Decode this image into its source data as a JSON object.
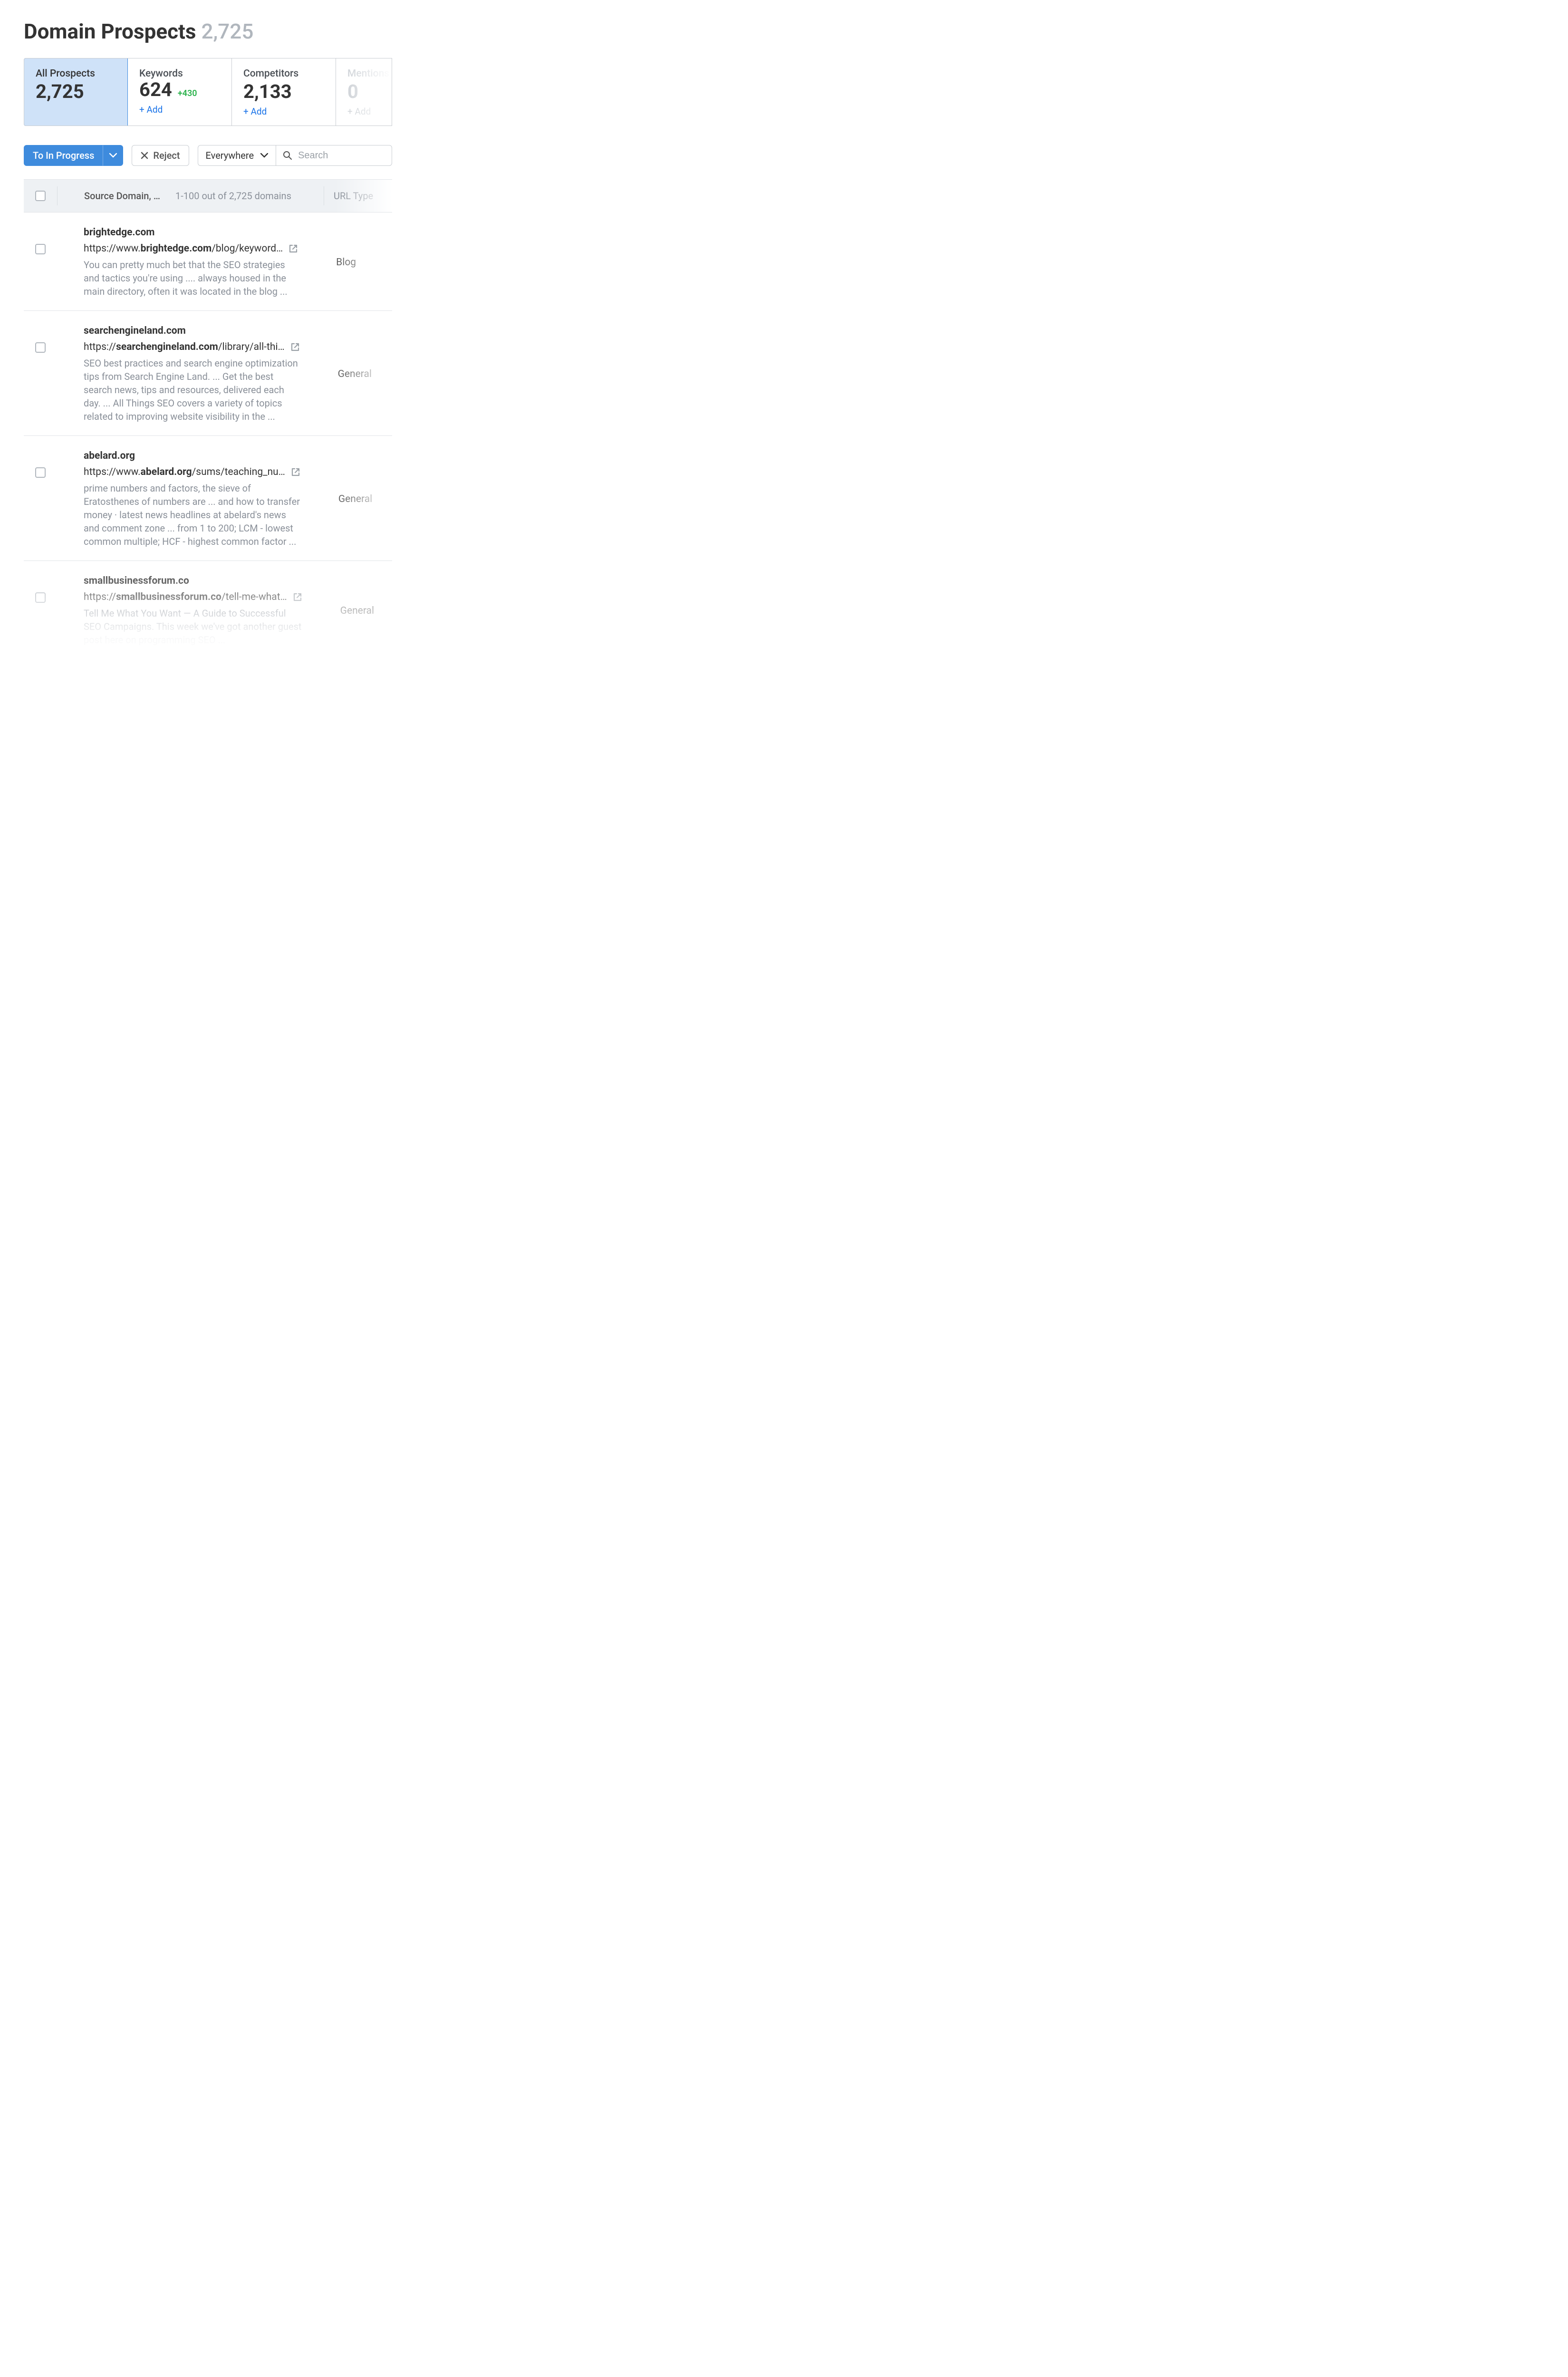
{
  "header": {
    "title": "Domain Prospects",
    "count": "2,725"
  },
  "stats": {
    "all": {
      "label": "All Prospects",
      "value": "2,725"
    },
    "keywords": {
      "label": "Keywords",
      "value": "624",
      "delta": "+430",
      "add": "+ Add"
    },
    "competitors": {
      "label": "Competitors",
      "value": "2,133",
      "add": "+ Add"
    },
    "mentions": {
      "label": "Mentions",
      "value": "0",
      "add": "+ Add"
    }
  },
  "toolbar": {
    "to_in_progress": "To In Progress",
    "reject": "Reject",
    "scope": "Everywhere",
    "search_placeholder": "Search"
  },
  "table": {
    "header": {
      "source": "Source Domain, …",
      "range": "1-100 out of 2,725 domains",
      "url_type": "URL Type"
    },
    "rows": [
      {
        "domain": "brightedge.com",
        "url_prefix": "https://www.",
        "url_bold": "brightedge.com",
        "url_suffix": "/blog/keyword…",
        "snippet": "You can pretty much bet that the SEO strategies and tactics you're using .... always housed in the main directory, often it was located in the blog ...",
        "type": "Blog"
      },
      {
        "domain": "searchengineland.com",
        "url_prefix": "https://",
        "url_bold": "searchengineland.com",
        "url_suffix": "/library/all-thi…",
        "snippet": "SEO best practices and search engine optimization tips from Search Engine Land. ... Get the best search news, tips and resources, delivered each day. ... All Things SEO covers a variety of topics related to improving website visibility in the ...",
        "type": "General"
      },
      {
        "domain": "abelard.org",
        "url_prefix": "https://www.",
        "url_bold": "abelard.org",
        "url_suffix": "/sums/teaching_nu…",
        "snippet": "prime numbers and factors, the sieve of Eratosthenes of numbers are ... and how to transfer money · latest news headlines at abelard's news and comment zone ... from 1 to 200; LCM - lowest common multiple; HCF - highest common factor ...",
        "type": "General"
      },
      {
        "domain": "smallbusinessforum.co",
        "url_prefix": "https://",
        "url_bold": "smallbusinessforum.co",
        "url_suffix": "/tell-me-what…",
        "snippet": "Tell Me What You Want — A Guide to Successful SEO Campaigns. This week we've got another guest post here on programming SEO ...",
        "type": "General"
      }
    ]
  }
}
